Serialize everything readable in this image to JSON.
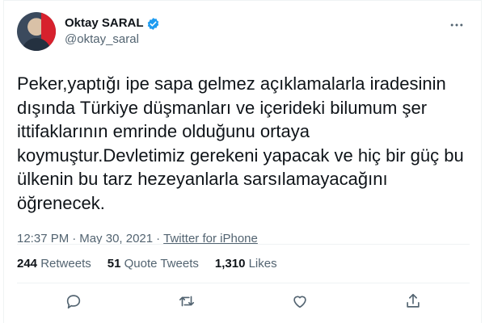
{
  "author": {
    "display_name": "Oktay SARAL",
    "handle": "@oktay_saral",
    "verified": true
  },
  "tweet": {
    "text": "Peker,yaptığı ipe sapa gelmez açıklamalarla iradesinin dışında Türkiye düşmanları ve içerideki bilumum şer ittifaklarının emrinde olduğunu ortaya koymuştur.Devletimiz gerekeni yapacak ve hiç bir güç bu ülkenin bu tarz hezeyanlarla sarsılamayacağını öğrenecek.",
    "time": "12:37 PM",
    "date": "May 30, 2021",
    "separator": "·",
    "source": "Twitter for iPhone"
  },
  "stats": {
    "retweets_count": "244",
    "retweets_label": "Retweets",
    "quotes_count": "51",
    "quotes_label": "Quote Tweets",
    "likes_count": "1,310",
    "likes_label": "Likes"
  },
  "icons": {
    "reply": "reply-icon",
    "retweet": "retweet-icon",
    "like": "like-icon",
    "share": "share-icon",
    "more": "more-icon",
    "verified": "verified-badge-icon"
  },
  "colors": {
    "text": "#0f1419",
    "secondary": "#536471",
    "verified": "#1d9bf0",
    "divider": "#eff3f4"
  }
}
